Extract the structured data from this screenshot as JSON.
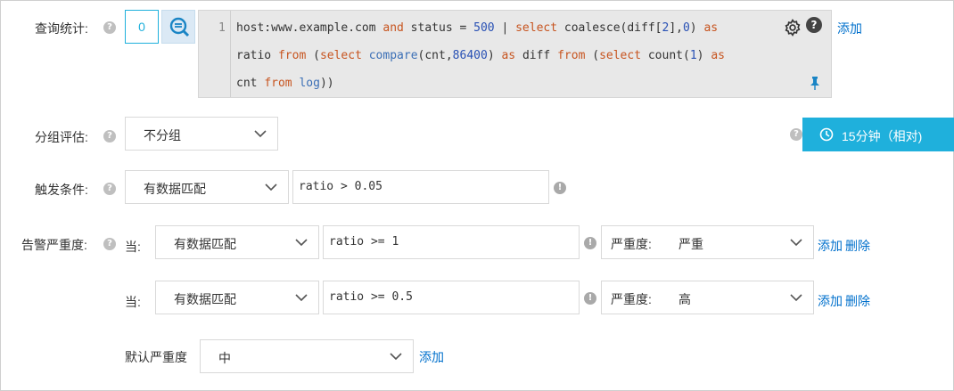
{
  "query": {
    "label": "查询统计:",
    "count_value": "0",
    "line_number": "1",
    "code_lines": [
      [
        [
          "host:www.example.com ",
          ""
        ],
        [
          "and",
          "kw"
        ],
        [
          " status = ",
          ""
        ],
        [
          "500",
          "num"
        ],
        [
          " | ",
          ""
        ],
        [
          "select",
          "kw"
        ],
        [
          " coalesce(diff[",
          ""
        ],
        [
          "2",
          "num"
        ],
        [
          "],",
          ""
        ],
        [
          "0",
          "num"
        ],
        [
          ") ",
          ""
        ],
        [
          "as",
          "kw"
        ]
      ],
      [
        [
          "ratio ",
          ""
        ],
        [
          "from",
          "kw"
        ],
        [
          " (",
          ""
        ],
        [
          "select",
          "kw"
        ],
        [
          " ",
          ""
        ],
        [
          "compare",
          "fn"
        ],
        [
          "(cnt,",
          ""
        ],
        [
          "86400",
          "num"
        ],
        [
          ") ",
          ""
        ],
        [
          "as",
          "kw"
        ],
        [
          " diff ",
          ""
        ],
        [
          "from",
          "kw"
        ],
        [
          " (",
          ""
        ],
        [
          "select",
          "kw"
        ],
        [
          " count(",
          ""
        ],
        [
          "1",
          "num"
        ],
        [
          ") ",
          ""
        ],
        [
          "as",
          "kw"
        ]
      ],
      [
        [
          "cnt ",
          ""
        ],
        [
          "from",
          "kw"
        ],
        [
          " ",
          ""
        ],
        [
          "log",
          "fn"
        ],
        [
          "))",
          ""
        ]
      ]
    ],
    "add_label": "添加"
  },
  "group": {
    "label": "分组评估:",
    "value": "不分组"
  },
  "time_range": {
    "label": "15分钟（相对)"
  },
  "trigger": {
    "label": "触发条件:",
    "match_value": "有数据匹配",
    "expression": "ratio > 0.05"
  },
  "severity": {
    "label": "告警严重度:",
    "when_label": "当:",
    "severity_prefix": "严重度:",
    "rules": [
      {
        "match": "有数据匹配",
        "expression": "ratio >= 1",
        "level": "严重",
        "add": "添加",
        "delete": "删除"
      },
      {
        "match": "有数据匹配",
        "expression": "ratio >= 0.5",
        "level": "高",
        "add": "添加",
        "delete": "删除"
      }
    ],
    "default_label": "默认严重度",
    "default_value": "中",
    "default_add": "添加"
  },
  "colors": {
    "accent": "#1fb0dc",
    "link": "#0070cc",
    "keyword": "#c7541f"
  }
}
